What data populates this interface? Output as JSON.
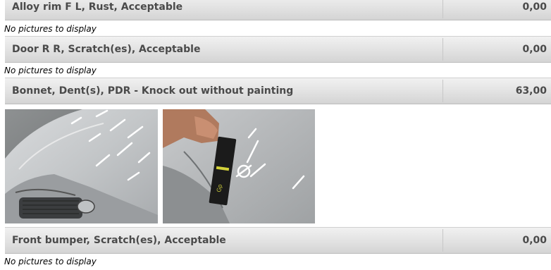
{
  "damage_items": [
    {
      "label": "Alloy rim F L, Rust, Acceptable",
      "amount": "0,00",
      "pictures_note": "No pictures to display"
    },
    {
      "label": "Door R R, Scratch(es), Acceptable",
      "amount": "0,00",
      "pictures_note": "No pictures to display"
    },
    {
      "label": "Bonnet, Dent(s), PDR - Knock out without painting",
      "amount": "63,00",
      "pictures": [
        "bonnet-photo-1",
        "bonnet-photo-2"
      ]
    },
    {
      "label": "Front bumper, Scratch(es), Acceptable",
      "amount": "0,00",
      "pictures_note": "No pictures to display"
    }
  ]
}
